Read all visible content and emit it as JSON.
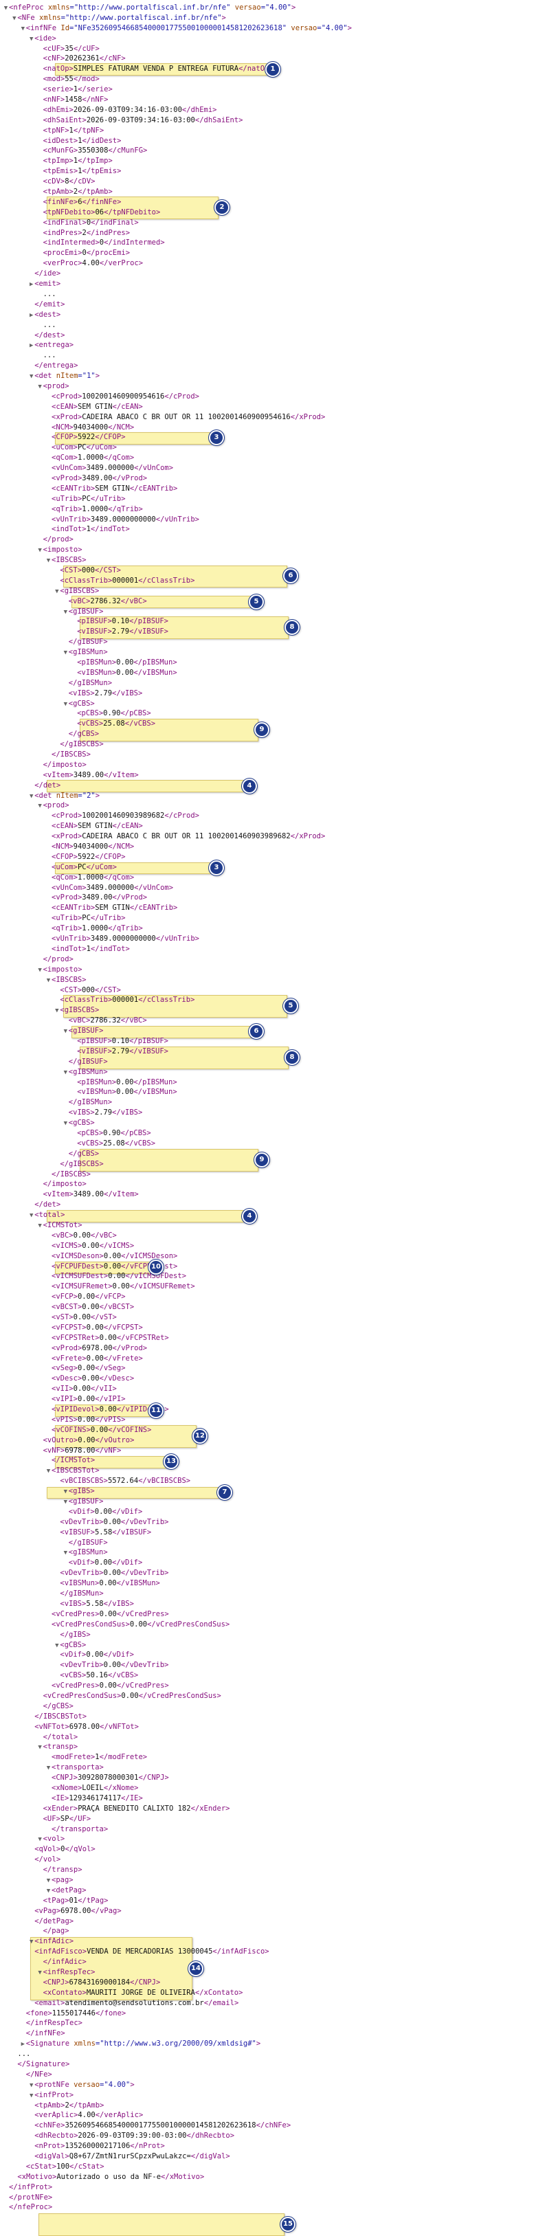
{
  "colors": {
    "tag": "#881280",
    "attr_name": "#994500",
    "attr_value": "#1a1aa6",
    "text": "#111111",
    "highlight": "#fbf4b0",
    "badge": "#1f3b8c"
  },
  "lines": [
    [
      "▼",
      "<",
      "nfeProc",
      " xmlns",
      "=\"http://www.portalfiscal.inf.br/nfe\"",
      " versao",
      "=\"4.00\"",
      ">"
    ],
    [
      "▼",
      "<",
      "NFe",
      " xmlns",
      "=\"http://www.portalfiscal.inf.br/nfe\"",
      ">"
    ],
    [
      "▼",
      "<",
      "infNFe",
      " Id",
      "=\"NFe35260954668540000177550010000014581202623618\"",
      " versao",
      "=\"4.00\"",
      ">"
    ],
    [
      "▼",
      "<",
      "ide",
      ">"
    ],
    [
      "",
      "<",
      "cUF",
      ">35</",
      "cUF",
      ">"
    ],
    [
      "",
      "<",
      "cNF",
      ">20262361</",
      "cNF",
      ">"
    ],
    [
      "",
      "<",
      "natOp",
      ">SIMPLES FATURAM VENDA P ENTREGA FUTURA</",
      "natOp",
      ">"
    ],
    [
      "",
      "<",
      "mod",
      ">55</",
      "mod",
      ">"
    ],
    [
      "",
      "<",
      "serie",
      ">1</",
      "serie",
      ">"
    ],
    [
      "",
      "<",
      "nNF",
      ">1458</",
      "nNF",
      ">"
    ],
    [
      "",
      "<",
      "dhEmi",
      ">2026-09-03T09:34:16-03:00</",
      "dhEmi",
      ">"
    ],
    [
      "",
      "<",
      "dhSaiEnt",
      ">2026-09-03T09:34:16-03:00</",
      "dhSaiEnt",
      ">"
    ],
    [
      "",
      "<",
      "tpNF",
      ">1</",
      "tpNF",
      ">"
    ],
    [
      "",
      "<",
      "idDest",
      ">1</",
      "idDest",
      ">"
    ],
    [
      "",
      "<",
      "cMunFG",
      ">3550308</",
      "cMunFG",
      ">"
    ],
    [
      "",
      "<",
      "tpImp",
      ">1</",
      "tpImp",
      ">"
    ],
    [
      "",
      "<",
      "tpEmis",
      ">1</",
      "tpEmis",
      ">"
    ],
    [
      "",
      "<",
      "cDV",
      ">8</",
      "cDV",
      ">"
    ],
    [
      "",
      "<",
      "tpAmb",
      ">2</",
      "tpAmb",
      ">"
    ],
    [
      "",
      "<",
      "finNFe",
      ">6</",
      "finNFe",
      ">"
    ],
    [
      "",
      "<",
      "tpNFDebito",
      ">06</",
      "tpNFDebito",
      ">"
    ],
    [
      "",
      "<",
      "indFinal",
      ">0</",
      "indFinal",
      ">"
    ],
    [
      "",
      "<",
      "indPres",
      ">2</",
      "indPres",
      ">"
    ],
    [
      "",
      "<",
      "indIntermed",
      ">0</",
      "indIntermed",
      ">"
    ],
    [
      "",
      "<",
      "procEmi",
      ">0</",
      "procEmi",
      ">"
    ],
    [
      "",
      "<",
      "verProc",
      ">4.00</",
      "verProc",
      ">"
    ],
    [
      "",
      "</",
      "ide",
      ">"
    ],
    [
      "▶",
      "<",
      "emit",
      ">"
    ],
    [
      "",
      "..."
    ],
    [
      "",
      "</",
      "emit",
      ">"
    ],
    [
      "▶",
      "<",
      "dest",
      ">"
    ],
    [
      "",
      "..."
    ],
    [
      "",
      "</",
      "dest",
      ">"
    ],
    [
      "▶",
      "<",
      "entrega",
      ">"
    ],
    [
      "",
      "..."
    ],
    [
      "",
      "</",
      "entrega",
      ">"
    ],
    [
      "▼",
      "<",
      "det",
      " nItem",
      "=\"1\"",
      ">"
    ],
    [
      "▼",
      "<",
      "prod",
      ">"
    ],
    [
      "",
      "<",
      "cProd",
      ">1002001460900954616</",
      "cProd",
      ">"
    ],
    [
      "",
      "<",
      "cEAN",
      ">SEM GTIN</",
      "cEAN",
      ">"
    ],
    [
      "",
      "<",
      "xProd",
      ">CADEIRA ABACO C BR OUT OR 11 1002001460900954616</",
      "xProd",
      ">"
    ],
    [
      "",
      "<",
      "NCM",
      ">94034000</",
      "NCM",
      ">"
    ],
    [
      "",
      "<",
      "CFOP",
      ">5922</",
      "CFOP",
      ">"
    ],
    [
      "",
      "<",
      "uCom",
      ">PC</",
      "uCom",
      ">"
    ],
    [
      "",
      "<",
      "qCom",
      ">1.0000</",
      "qCom",
      ">"
    ],
    [
      "",
      "<",
      "vUnCom",
      ">3489.000000</",
      "vUnCom",
      ">"
    ],
    [
      "",
      "<",
      "vProd",
      ">3489.00</",
      "vProd",
      ">"
    ],
    [
      "",
      "<",
      "cEANTrib",
      ">SEM GTIN</",
      "cEANTrib",
      ">"
    ],
    [
      "",
      "<",
      "uTrib",
      ">PC</",
      "uTrib",
      ">"
    ],
    [
      "",
      "<",
      "qTrib",
      ">1.0000</",
      "qTrib",
      ">"
    ],
    [
      "",
      "<",
      "vUnTrib",
      ">3489.0000000000</",
      "vUnTrib",
      ">"
    ],
    [
      "",
      "<",
      "indTot",
      ">1</",
      "indTot",
      ">"
    ],
    [
      "",
      "</",
      "prod",
      ">"
    ],
    [
      "▼",
      "<",
      "imposto",
      ">"
    ],
    [
      "▼",
      "<",
      "IBSCBS",
      ">"
    ],
    [
      "",
      "<",
      "CST",
      ">000</",
      "CST",
      ">"
    ],
    [
      "",
      "<",
      "cClassTrib",
      ">000001</",
      "cClassTrib",
      ">"
    ],
    [
      "▼",
      "<",
      "gIBSCBS",
      ">"
    ],
    [
      "",
      "<",
      "vBC",
      ">2786.32</",
      "vBC",
      ">"
    ],
    [
      "▼",
      "<",
      "gIBSUF",
      ">"
    ],
    [
      "",
      "<",
      "pIBSUF",
      ">0.10</",
      "pIBSUF",
      ">"
    ],
    [
      "",
      "<",
      "vIBSUF",
      ">2.79</",
      "vIBSUF",
      ">"
    ],
    [
      "",
      "</",
      "gIBSUF",
      ">"
    ],
    [
      "▼",
      "<",
      "gIBSMun",
      ">"
    ],
    [
      "",
      "<",
      "pIBSMun",
      ">0.00</",
      "pIBSMun",
      ">"
    ],
    [
      "",
      "<",
      "vIBSMun",
      ">0.00</",
      "vIBSMun",
      ">"
    ],
    [
      "",
      "</",
      "gIBSMun",
      ">"
    ],
    [
      "",
      "<",
      "vIBS",
      ">2.79</",
      "vIBS",
      ">"
    ],
    [
      "▼",
      "<",
      "gCBS",
      ">"
    ],
    [
      "",
      "<",
      "pCBS",
      ">0.90</",
      "pCBS",
      ">"
    ],
    [
      "",
      "<",
      "vCBS",
      ">25.08</",
      "vCBS",
      ">"
    ],
    [
      "",
      "</",
      "gCBS",
      ">"
    ],
    [
      "",
      "</",
      "gIBSCBS",
      ">"
    ],
    [
      "",
      "</",
      "IBSCBS",
      ">"
    ],
    [
      "",
      "</",
      "imposto",
      ">"
    ],
    [
      "",
      "<",
      "vItem",
      ">3489.00</",
      "vItem",
      ">"
    ],
    [
      "",
      "</",
      "det",
      ">"
    ],
    [
      "▼",
      "<",
      "det",
      " nItem",
      "=\"2\"",
      ">"
    ],
    [
      "▼",
      "<",
      "prod",
      ">"
    ],
    [
      "",
      "<",
      "cProd",
      ">1002001460903989682</",
      "cProd",
      ">"
    ],
    [
      "",
      "<",
      "cEAN",
      ">SEM GTIN</",
      "cEAN",
      ">"
    ],
    [
      "",
      "<",
      "xProd",
      ">CADEIRA ABACO C BR OUT OR 11 1002001460903989682</",
      "xProd",
      ">"
    ],
    [
      "",
      "<",
      "NCM",
      ">94034000</",
      "NCM",
      ">"
    ],
    [
      "",
      "<",
      "CFOP",
      ">5922</",
      "CFOP",
      ">"
    ],
    [
      "",
      "<",
      "uCom",
      ">PC</",
      "uCom",
      ">"
    ],
    [
      "",
      "<",
      "qCom",
      ">1.0000</",
      "qCom",
      ">"
    ],
    [
      "",
      "<",
      "vUnCom",
      ">3489.000000</",
      "vUnCom",
      ">"
    ],
    [
      "",
      "<",
      "vProd",
      ">3489.00</",
      "vProd",
      ">"
    ],
    [
      "",
      "<",
      "cEANTrib",
      ">SEM GTIN</",
      "cEANTrib",
      ">"
    ],
    [
      "",
      "<",
      "uTrib",
      ">PC</",
      "uTrib",
      ">"
    ],
    [
      "",
      "<",
      "qTrib",
      ">1.0000</",
      "qTrib",
      ">"
    ],
    [
      "",
      "<",
      "vUnTrib",
      ">3489.0000000000</",
      "vUnTrib",
      ">"
    ],
    [
      "",
      "<",
      "indTot",
      ">1</",
      "indTot",
      ">"
    ],
    [
      "",
      "</",
      "prod",
      ">"
    ],
    [
      "▼",
      "<",
      "imposto",
      ">"
    ],
    [
      "▼",
      "<",
      "IBSCBS",
      ">"
    ],
    [
      "",
      "<",
      "CST",
      ">000</",
      "CST",
      ">"
    ],
    [
      "",
      "<",
      "cClassTrib",
      ">000001</",
      "cClassTrib",
      ">"
    ],
    [
      "▼",
      "<",
      "gIBSCBS",
      ">"
    ],
    [
      "",
      "<",
      "vBC",
      ">2786.32</",
      "vBC",
      ">"
    ],
    [
      "▼",
      "<",
      "gIBSUF",
      ">"
    ],
    [
      "",
      "<",
      "pIBSUF",
      ">0.10</",
      "pIBSUF",
      ">"
    ],
    [
      "",
      "<",
      "vIBSUF",
      ">2.79</",
      "vIBSUF",
      ">"
    ],
    [
      "",
      "</",
      "gIBSUF",
      ">"
    ],
    [
      "▼",
      "<",
      "gIBSMun",
      ">"
    ],
    [
      "",
      "<",
      "pIBSMun",
      ">0.00</",
      "pIBSMun",
      ">"
    ],
    [
      "",
      "<",
      "vIBSMun",
      ">0.00</",
      "vIBSMun",
      ">"
    ],
    [
      "",
      "</",
      "gIBSMun",
      ">"
    ],
    [
      "",
      "<",
      "vIBS",
      ">2.79</",
      "vIBS",
      ">"
    ],
    [
      "▼",
      "<",
      "gCBS",
      ">"
    ],
    [
      "",
      "<",
      "pCBS",
      ">0.90</",
      "pCBS",
      ">"
    ],
    [
      "",
      "<",
      "vCBS",
      ">25.08</",
      "vCBS",
      ">"
    ],
    [
      "",
      "</",
      "gCBS",
      ">"
    ],
    [
      "",
      "</",
      "gIBSCBS",
      ">"
    ],
    [
      "",
      "</",
      "IBSCBS",
      ">"
    ],
    [
      "",
      "</",
      "imposto",
      ">"
    ],
    [
      "",
      "<",
      "vItem",
      ">3489.00</",
      "vItem",
      ">"
    ],
    [
      "",
      "</",
      "det",
      ">"
    ],
    [
      "▼",
      "<",
      "total",
      ">"
    ],
    [
      "▼",
      "<",
      "ICMSTot",
      ">"
    ],
    [
      "",
      "<",
      "vBC",
      ">0.00</",
      "vBC",
      ">"
    ],
    [
      "",
      "<",
      "vICMS",
      ">0.00</",
      "vICMS",
      ">"
    ],
    [
      "",
      "<",
      "vICMSDeson",
      ">0.00</",
      "vICMSDeson",
      ">"
    ],
    [
      "",
      "<",
      "vFCPUFDest",
      ">0.00</",
      "vFCPUFDest",
      ">"
    ],
    [
      "",
      "<",
      "vICMSUFDest",
      ">0.00</",
      "vICMSUFDest",
      ">"
    ],
    [
      "",
      "<",
      "vICMSUFRemet",
      ">0.00</",
      "vICMSUFRemet",
      ">"
    ],
    [
      "",
      "<",
      "vFCP",
      ">0.00</",
      "vFCP",
      ">"
    ],
    [
      "",
      "<",
      "vBCST",
      ">0.00</",
      "vBCST",
      ">"
    ],
    [
      "",
      "<",
      "vST",
      ">0.00</",
      "vST",
      ">"
    ],
    [
      "",
      "<",
      "vFCPST",
      ">0.00</",
      "vFCPST",
      ">"
    ],
    [
      "",
      "<",
      "vFCPSTRet",
      ">0.00</",
      "vFCPSTRet",
      ">"
    ],
    [
      "",
      "<",
      "vProd",
      ">6978.00</",
      "vProd",
      ">"
    ],
    [
      "",
      "<",
      "vFrete",
      ">0.00</",
      "vFrete",
      ">"
    ],
    [
      "",
      "<",
      "vSeg",
      ">0.00</",
      "vSeg",
      ">"
    ],
    [
      "",
      "<",
      "vDesc",
      ">0.00</",
      "vDesc",
      ">"
    ],
    [
      "",
      "<",
      "vII",
      ">0.00</",
      "vII",
      ">"
    ],
    [
      "",
      "<",
      "vIPI",
      ">0.00</",
      "vIPI",
      ">"
    ],
    [
      "",
      "<",
      "vIPIDevol",
      ">0.00</",
      "vIPIDevol",
      ">"
    ],
    [
      "",
      "<",
      "vPIS",
      ">0.00</",
      "vPIS",
      ">"
    ],
    [
      "",
      "<",
      "vCOFINS",
      ">0.00</",
      "vCOFINS",
      ">"
    ],
    [
      "",
      "<",
      "vOutro",
      ">0.00</",
      "vOutro",
      ">"
    ],
    [
      "",
      "<",
      "vNF",
      ">6978.00</",
      "vNF",
      ">"
    ],
    [
      "",
      "</",
      "ICMSTot",
      ">"
    ],
    [
      "▼",
      "<",
      "IBSCBSTot",
      ">"
    ],
    [
      "",
      "<",
      "vBCIBSCBS",
      ">5572.64</",
      "vBCIBSCBS",
      ">"
    ],
    [
      "▼",
      "<",
      "gIBS",
      ">"
    ],
    [
      "▼",
      "<",
      "gIBSUF",
      ">"
    ],
    [
      "",
      "<",
      "vDif",
      ">0.00</",
      "vDif",
      ">"
    ],
    [
      "",
      "<",
      "vDevTrib",
      ">0.00</",
      "vDevTrib",
      ">"
    ],
    [
      "",
      "<",
      "vIBSUF",
      ">5.58</",
      "vIBSUF",
      ">"
    ],
    [
      "",
      "</",
      "gIBSUF",
      ">"
    ],
    [
      "▼",
      "<",
      "gIBSMun",
      ">"
    ],
    [
      "",
      "<",
      "vDif",
      ">0.00</",
      "vDif",
      ">"
    ],
    [
      "",
      "<",
      "vDevTrib",
      ">0.00</",
      "vDevTrib",
      ">"
    ],
    [
      "",
      "<",
      "vIBSMun",
      ">0.00</",
      "vIBSMun",
      ">"
    ],
    [
      "",
      "</",
      "gIBSMun",
      ">"
    ],
    [
      "",
      "<",
      "vIBS",
      ">5.58</",
      "vIBS",
      ">"
    ],
    [
      "",
      "<",
      "vCredPres",
      ">0.00</",
      "vCredPres",
      ">"
    ],
    [
      "",
      "<",
      "vCredPresCondSus",
      ">0.00</",
      "vCredPresCondSus",
      ">"
    ],
    [
      "",
      "</",
      "gIBS",
      ">"
    ],
    [
      "▼",
      "<",
      "gCBS",
      ">"
    ],
    [
      "",
      "<",
      "vDif",
      ">0.00</",
      "vDif",
      ">"
    ],
    [
      "",
      "<",
      "vDevTrib",
      ">0.00</",
      "vDevTrib",
      ">"
    ],
    [
      "",
      "<",
      "vCBS",
      ">50.16</",
      "vCBS",
      ">"
    ],
    [
      "",
      "<",
      "vCredPres",
      ">0.00</",
      "vCredPres",
      ">"
    ],
    [
      "",
      "<",
      "vCredPresCondSus",
      ">0.00</",
      "vCredPresCondSus",
      ">"
    ],
    [
      "",
      "</",
      "gCBS",
      ">"
    ],
    [
      "",
      "</",
      "IBSCBSTot",
      ">"
    ],
    [
      "",
      "<",
      "vNFTot",
      ">6978.00</",
      "vNFTot",
      ">"
    ],
    [
      "",
      "</",
      "total",
      ">"
    ],
    [
      "▼",
      "<",
      "transp",
      ">"
    ],
    [
      "",
      "<",
      "modFrete",
      ">1</",
      "modFrete",
      ">"
    ],
    [
      "▼",
      "<",
      "transporta",
      ">"
    ],
    [
      "",
      "<",
      "CNPJ",
      ">30928078000301</",
      "CNPJ",
      ">"
    ],
    [
      "",
      "<",
      "xNome",
      ">LOEIL</",
      "xNome",
      ">"
    ],
    [
      "",
      "<",
      "IE",
      ">129346174117</",
      "IE",
      ">"
    ],
    [
      "",
      "<",
      "xEnder",
      ">PRAÇA BENEDITO CALIXTO 182</",
      "xEnder",
      ">"
    ],
    [
      "",
      "<",
      "UF",
      ">SP</",
      "UF",
      ">"
    ],
    [
      "",
      "</",
      "transporta",
      ">"
    ],
    [
      "▼",
      "<",
      "vol",
      ">"
    ],
    [
      "",
      "<",
      "qVol",
      ">0</",
      "qVol",
      ">"
    ],
    [
      "",
      "</",
      "vol",
      ">"
    ],
    [
      "",
      "</",
      "transp",
      ">"
    ],
    [
      "▼",
      "<",
      "pag",
      ">"
    ],
    [
      "▼",
      "<",
      "detPag",
      ">"
    ],
    [
      "",
      "<",
      "tPag",
      ">01</",
      "tPag",
      ">"
    ],
    [
      "",
      "<",
      "vPag",
      ">6978.00</",
      "vPag",
      ">"
    ],
    [
      "",
      "</",
      "detPag",
      ">"
    ],
    [
      "",
      "</",
      "pag",
      ">"
    ],
    [
      "▼",
      "<",
      "infAdic",
      ">"
    ],
    [
      "",
      "<",
      "infAdFisco",
      ">VENDA DE MERCADORIAS 13000045</",
      "infAdFisco",
      ">"
    ],
    [
      "",
      "</",
      "infAdic",
      ">"
    ],
    [
      "▼",
      "<",
      "infRespTec",
      ">"
    ],
    [
      "",
      "<",
      "CNPJ",
      ">67843169000184</",
      "CNPJ",
      ">"
    ],
    [
      "",
      "<",
      "xContato",
      ">MAURITI JORGE DE OLIVEIRA</",
      "xContato",
      ">"
    ],
    [
      "",
      "<",
      "email",
      ">atendimento@sendsolutions.com.br</",
      "email",
      ">"
    ],
    [
      "",
      "<",
      "fone",
      ">1155017446</",
      "fone",
      ">"
    ],
    [
      "",
      "</",
      "infRespTec",
      ">"
    ],
    [
      "",
      "</",
      "infNFe",
      ">"
    ],
    [
      "▶",
      "<",
      "Signature",
      " xmlns",
      "=\"http://www.w3.org/2000/09/xmldsig#\"",
      ">"
    ],
    [
      "",
      "..."
    ],
    [
      "",
      "</",
      "Signature",
      ">"
    ],
    [
      "",
      "</",
      "NFe",
      ">"
    ],
    [
      "▼",
      "<",
      "protNFe",
      " versao",
      "=\"4.00\"",
      ">"
    ],
    [
      "▼",
      "<",
      "infProt",
      ">"
    ],
    [
      "",
      "<",
      "tpAmb",
      ">2</",
      "tpAmb",
      ">"
    ],
    [
      "",
      "<",
      "verAplic",
      ">4.00</",
      "verAplic",
      ">"
    ],
    [
      "",
      "<",
      "chNFe",
      ">35260954668540000177550010000014581202623618</",
      "chNFe",
      ">"
    ],
    [
      "",
      "<",
      "dhRecbto",
      ">2026-09-03T09:39:00-03:00</",
      "dhRecbto",
      ">"
    ],
    [
      "",
      "<",
      "nProt",
      ">135260000217106</",
      "nProt",
      ">"
    ],
    [
      "",
      "<",
      "digVal",
      ">Q8+67/ZmtN1rurSCpzxPwuLakzc=</",
      "digVal",
      ">"
    ],
    [
      "",
      "<",
      "cStat",
      ">100</",
      "cStat",
      ">"
    ],
    [
      "",
      "<",
      "xMotivo",
      ">Autorizado o uso da NF-e</",
      "xMotivo",
      ">"
    ],
    [
      "",
      "</",
      "infProt",
      ">"
    ],
    [
      "",
      "</",
      "protNFe",
      ">"
    ],
    [
      "",
      "</",
      "nfeProc",
      ">"
    ]
  ],
  "badges": [
    "1",
    "2",
    "3",
    "6",
    "5",
    "8",
    "9",
    "4",
    "3",
    "5",
    "6",
    "8",
    "9",
    "4",
    "10",
    "11",
    "12",
    "13",
    "7",
    "14",
    "15"
  ]
}
